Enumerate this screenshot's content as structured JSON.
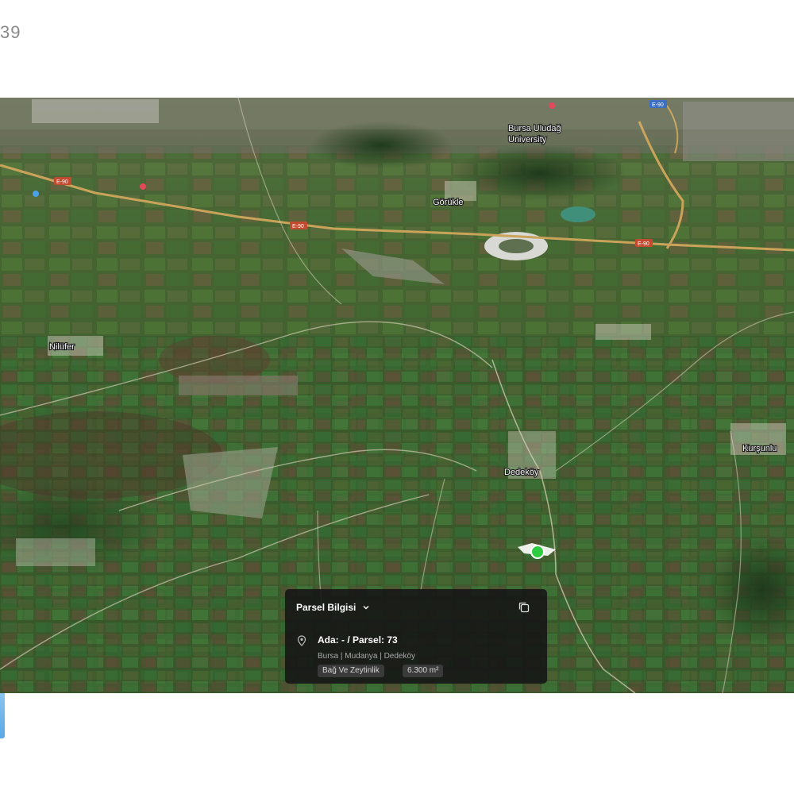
{
  "page": {
    "corner_number": "39"
  },
  "map": {
    "labels": {
      "university": "Bursa Uludağ",
      "university_line2": "University",
      "town_top_mid": "Görükle",
      "town_left": "Nilüfer",
      "town_right": "Kurşunlu",
      "village_center": "Dedeköy"
    },
    "road_badges": {
      "highway_a": "E-90",
      "highway_b": "E-90",
      "highway_c": "E-90",
      "highway_d": "E-90"
    },
    "marker": {
      "color": "#2ecc40"
    }
  },
  "panel": {
    "title": "Parsel Bilgisi",
    "parcel_id": "Ada: - / Parsel: 73",
    "location": "Bursa | Mudanya | Dedeköy",
    "land_use": "Bağ Ve Zeytinlik",
    "area": "6.300 m²",
    "icons": {
      "chevron": "chevron-down-icon",
      "copy": "copy-icon",
      "pin": "location-pin-icon"
    }
  },
  "colors": {
    "panel_background": "#161616",
    "marker": "#2ecc40",
    "accent": "#5aa9e6"
  }
}
